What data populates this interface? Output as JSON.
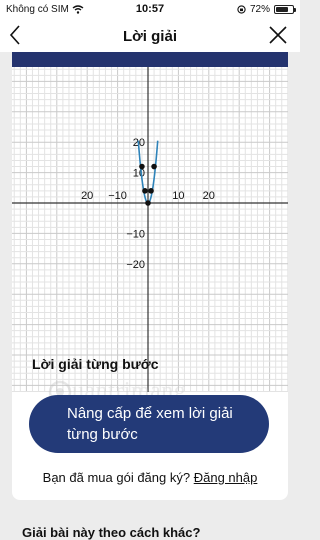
{
  "status_bar": {
    "carrier": "Không có SIM",
    "time": "10:57",
    "battery_text": "72%",
    "battery_level": 0.72
  },
  "nav": {
    "title": "Lời giải"
  },
  "graph": {
    "x_tick_labels": [
      "20",
      "−10",
      "10",
      "20"
    ],
    "y_tick_labels": [
      "20",
      "10",
      "−10",
      "−20"
    ],
    "curve": {
      "type": "parabola",
      "a": 2,
      "b": 0,
      "c": 0,
      "color": "#2e83b9"
    },
    "points": [
      [
        -2,
        12
      ],
      [
        2,
        12
      ],
      [
        -1,
        4
      ],
      [
        1,
        4
      ],
      [
        0,
        0
      ]
    ]
  },
  "solution": {
    "section_title": "Lời giải từng bước",
    "upgrade_button_label": "Nâng cấp để xem lời giải từng bước",
    "login_prompt": "Bạn đã mua gói đăng ký?",
    "login_link": "Đăng nhập"
  },
  "watermark": {
    "text": "uantrimang"
  },
  "footer": {
    "other_method": "Giải bài này theo cách khác?"
  },
  "colors": {
    "brand_navy": "#233a78",
    "curve_blue": "#2e83b9"
  }
}
